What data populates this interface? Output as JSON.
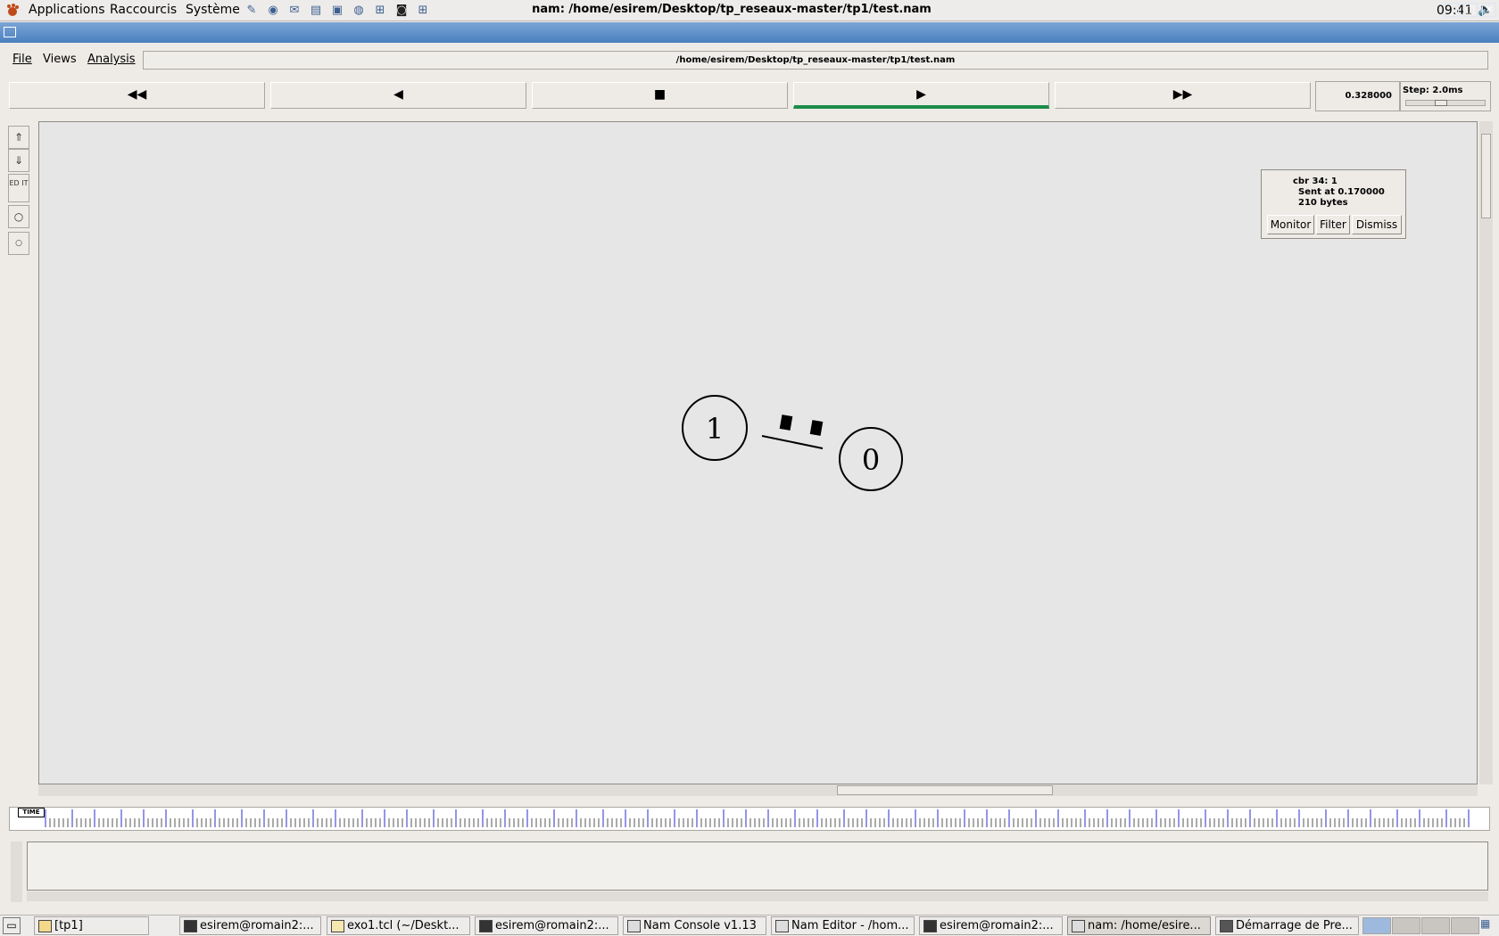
{
  "top_panel": {
    "menus": [
      "Applications",
      "Raccourcis",
      "Système"
    ],
    "launchers": [
      "text-editor-icon",
      "browser-icon",
      "mail-icon",
      "terminal-icon",
      "image-viewer-icon",
      "globe-icon",
      "network-icon",
      "camera-icon",
      "network2-icon"
    ],
    "clock": "09:41"
  },
  "window": {
    "title": "nam: /home/esirem/Desktop/tp_reseaux-master/tp1/test.nam"
  },
  "menubar": {
    "file": "File",
    "views": "Views",
    "analysis": "Analysis",
    "filepath": "/home/esirem/Desktop/tp_reseaux-master/tp1/test.nam"
  },
  "transport": {
    "rewind": "◀◀",
    "back": "◀",
    "stop": "■",
    "play": "▶",
    "forward": "▶▶",
    "time": "0.328000",
    "step": "Step: 2.0ms"
  },
  "tools": {
    "edit": "ED IT"
  },
  "nodes": [
    {
      "id": "1"
    },
    {
      "id": "0"
    }
  ],
  "popup": {
    "line1": "cbr 34: 1",
    "line2": "Sent at 0.170000",
    "line3": "210 bytes",
    "monitor": "Monitor",
    "filter": "Filter",
    "dismiss": "Dismiss"
  },
  "timeline": {
    "badge": "TIME"
  },
  "taskbar": {
    "tasks": [
      "[tp1]",
      "esirem@romain2:...",
      "exo1.tcl (~/Deskt...",
      "esirem@romain2:...",
      "Nam Console v1.13",
      "Nam Editor - /hom...",
      "esirem@romain2:...",
      "nam: /home/esire...",
      "Démarrage de Pre..."
    ]
  }
}
